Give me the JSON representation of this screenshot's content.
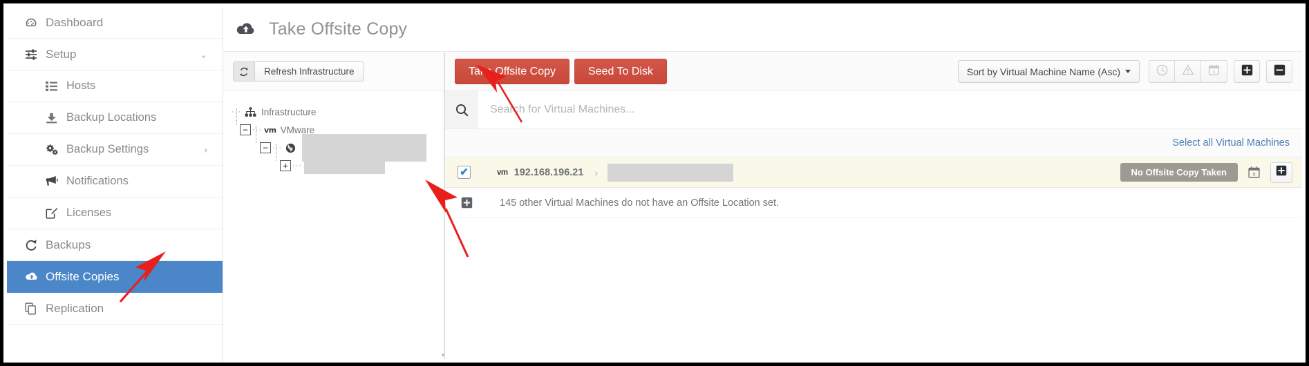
{
  "sidebar": {
    "items": [
      {
        "label": "Dashboard",
        "icon": "dashboard-icon",
        "level": "top",
        "active": false,
        "caret": ""
      },
      {
        "label": "Setup",
        "icon": "sliders-icon",
        "level": "top",
        "active": false,
        "caret": "⌄"
      },
      {
        "label": "Hosts",
        "icon": "list-icon",
        "level": "sub",
        "active": false,
        "caret": ""
      },
      {
        "label": "Backup Locations",
        "icon": "download-icon",
        "level": "sub",
        "active": false,
        "caret": ""
      },
      {
        "label": "Backup Settings",
        "icon": "gears-icon",
        "level": "sub",
        "active": false,
        "caret": "›"
      },
      {
        "label": "Notifications",
        "icon": "megaphone-icon",
        "level": "sub",
        "active": false,
        "caret": ""
      },
      {
        "label": "Licenses",
        "icon": "edit-square-icon",
        "level": "sub",
        "active": false,
        "caret": ""
      },
      {
        "label": "Backups",
        "icon": "refresh-icon",
        "level": "top",
        "active": false,
        "caret": ""
      },
      {
        "label": "Offsite Copies",
        "icon": "cloud-upload-icon",
        "level": "top",
        "active": true,
        "caret": ""
      },
      {
        "label": "Replication",
        "icon": "copy-icon",
        "level": "top",
        "active": false,
        "caret": ""
      }
    ],
    "active_color": "#4a86c8"
  },
  "header": {
    "title": "Take Offsite Copy",
    "icon": "cloud-upload-icon"
  },
  "tree_panel": {
    "refresh_button": {
      "label": "Refresh Infrastructure",
      "icon": "refresh-icon"
    },
    "nodes": [
      {
        "label": "Infrastructure",
        "icon": "sitemap-icon",
        "toggle": "",
        "redacted": false,
        "depth": 0
      },
      {
        "label": "VMware",
        "icon": "vm-badge",
        "toggle": "−",
        "redacted": false,
        "depth": 1
      },
      {
        "label": "",
        "icon": "globe-icon",
        "toggle": "−",
        "redacted": true,
        "depth": 2
      },
      {
        "label": "",
        "icon": "",
        "toggle": "+",
        "redacted": true,
        "depth": 3
      }
    ]
  },
  "list_panel": {
    "toolbar": {
      "take_offsite_copy_label": "Take Offsite Copy",
      "seed_to_disk_label": "Seed To Disk",
      "danger_color": "#cb4b3c",
      "sort_label": "Sort by Virtual Machine Name (Asc)",
      "icon_buttons": [
        {
          "name": "clock-icon",
          "glyph": "◴",
          "disabled": true
        },
        {
          "name": "warning-icon",
          "glyph": "⚠",
          "disabled": true
        },
        {
          "name": "calendar-x-icon",
          "glyph": "Ὕ3",
          "disabled": true
        }
      ],
      "expand_all_label": "+",
      "collapse_all_label": "−"
    },
    "search": {
      "placeholder": "Search for Virtual Machines...",
      "value": "",
      "icon": "search-icon"
    },
    "select_all_label": "Select all Virtual Machines",
    "rows": [
      {
        "checked": true,
        "vm_badge": "vm",
        "name": "192.168.196.21",
        "chevron": "›",
        "redacted_name": true,
        "status": "No Offsite Copy Taken",
        "status_color": "#9b9b93",
        "row_background": "#faf8e8",
        "calendar_icon": "calendar-x-icon",
        "add_icon": "plus-square-icon"
      }
    ],
    "other_machines": {
      "expand_icon": "plus-square-icon",
      "text": "145 other Virtual Machines do not have an Offsite Location set.",
      "count": 145
    }
  },
  "annotations": {
    "arrow_color": "#e8201c",
    "arrows": [
      {
        "name": "arrow-to-offsite-copies"
      },
      {
        "name": "arrow-to-take-offsite-copy"
      },
      {
        "name": "arrow-to-row-checkbox"
      }
    ]
  }
}
